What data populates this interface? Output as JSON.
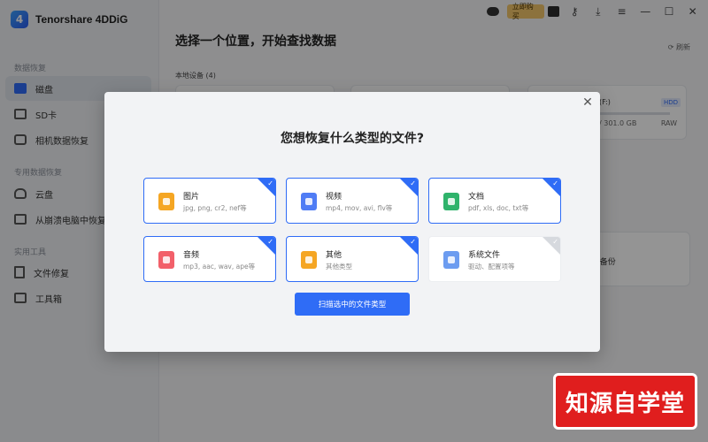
{
  "app": {
    "name": "Tenorshare 4DDiG",
    "logo_letter": "4"
  },
  "topbar": {
    "buy_label": "立即购买",
    "icons": [
      "chat-icon",
      "vip-badge-icon",
      "tool-icon",
      "download-icon",
      "menu-icon",
      "minimize-icon",
      "maximize-icon",
      "close-icon"
    ]
  },
  "sidebar": {
    "sections": [
      {
        "title": "数据恢复",
        "items": [
          {
            "label": "磁盘",
            "icon": "disk-icon",
            "active": true
          },
          {
            "label": "SD卡",
            "icon": "sd-card-icon"
          },
          {
            "label": "相机数据恢复",
            "icon": "camera-icon"
          }
        ]
      },
      {
        "title": "专用数据恢复",
        "items": [
          {
            "label": "云盘",
            "icon": "cloud-icon"
          },
          {
            "label": "从崩溃电脑中恢复",
            "icon": "monitor-icon"
          }
        ]
      },
      {
        "title": "实用工具",
        "items": [
          {
            "label": "文件修复",
            "icon": "file-repair-icon"
          },
          {
            "label": "工具箱",
            "icon": "toolbox-icon"
          }
        ]
      }
    ]
  },
  "main": {
    "title": "选择一个位置，开始查找数据",
    "refresh_label": "刷新",
    "local_devices_label": "本地设备 (4)",
    "disk_card": {
      "name": "(F:)",
      "type": "HDD",
      "size": "/ 301.0 GB",
      "fs": "RAW"
    },
    "backup_fragment": "s备份"
  },
  "modal": {
    "title": "您想恢复什么类型的文件?",
    "file_types": [
      {
        "name": "图片",
        "desc": "jpg, png, cr2, nef等",
        "checked": true,
        "color": "#f5a623"
      },
      {
        "name": "视频",
        "desc": "mp4, mov, avi, flv等",
        "checked": true,
        "color": "#4f7cf5"
      },
      {
        "name": "文档",
        "desc": "pdf, xls, doc, txt等",
        "checked": true,
        "color": "#2fb36b"
      },
      {
        "name": "音频",
        "desc": "mp3, aac, wav, ape等",
        "checked": true,
        "color": "#f2606a"
      },
      {
        "name": "其他",
        "desc": "其他类型",
        "checked": true,
        "color": "#f5a623"
      },
      {
        "name": "系统文件",
        "desc": "驱动、配置项等",
        "checked": false,
        "color": "#6c9cf0"
      }
    ],
    "scan_button": "扫描选中的文件类型",
    "close_symbol": "✕"
  },
  "watermark": "知源自学堂"
}
